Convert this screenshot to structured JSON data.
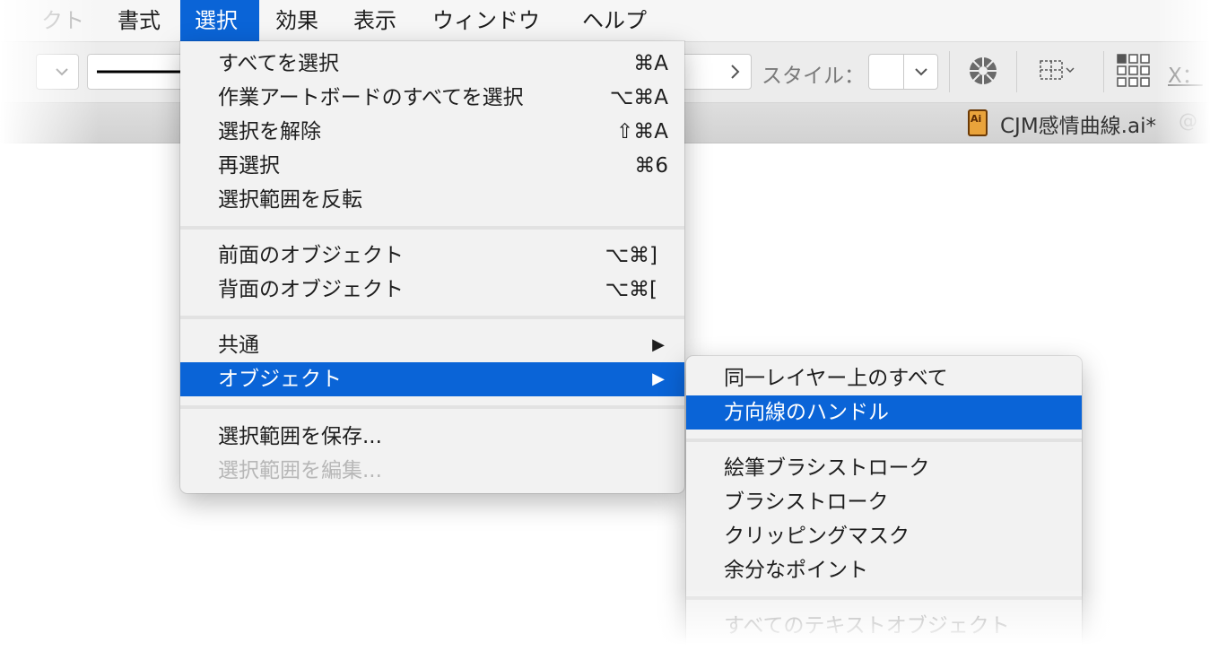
{
  "menubar": {
    "items": [
      {
        "label": "クト"
      },
      {
        "label": "書式"
      },
      {
        "label": "選択"
      },
      {
        "label": "効果"
      },
      {
        "label": "表示"
      },
      {
        "label": "ウィンドウ"
      },
      {
        "label": "ヘルプ"
      }
    ]
  },
  "toolbar": {
    "style_label": "スタイル：",
    "x_label": "X："
  },
  "document": {
    "title": "CJM感情曲線.ai*",
    "trailing": "@",
    "icon_text": "Ai"
  },
  "select_menu": {
    "items": [
      {
        "label": "すべてを選択",
        "shortcut": "⌘A"
      },
      {
        "label": "作業アートボードのすべてを選択",
        "shortcut": "⌥⌘A"
      },
      {
        "label": "選択を解除",
        "shortcut": "⇧⌘A"
      },
      {
        "label": "再選択",
        "shortcut": "⌘6"
      },
      {
        "label": "選択範囲を反転",
        "shortcut": ""
      },
      {
        "label": "前面のオブジェクト",
        "shortcut": "⌥⌘]"
      },
      {
        "label": "背面のオブジェクト",
        "shortcut": "⌥⌘["
      },
      {
        "label": "共通",
        "shortcut": "▶"
      },
      {
        "label": "オブジェクト",
        "shortcut": "▶"
      },
      {
        "label": "選択範囲を保存...",
        "shortcut": ""
      },
      {
        "label": "選択範囲を編集...",
        "shortcut": ""
      }
    ]
  },
  "object_submenu": {
    "items": [
      {
        "label": "同一レイヤー上のすべて"
      },
      {
        "label": "方向線のハンドル"
      },
      {
        "label": "絵筆ブラシストローク"
      },
      {
        "label": "ブラシストローク"
      },
      {
        "label": "クリッピングマスク"
      },
      {
        "label": "余分なポイント"
      },
      {
        "label": "すべてのテキストオブジェクト"
      }
    ]
  },
  "colors": {
    "highlight": "#0a64d7",
    "menu_bg": "#f2f2f2",
    "disabled_text": "#b7b7b7"
  }
}
